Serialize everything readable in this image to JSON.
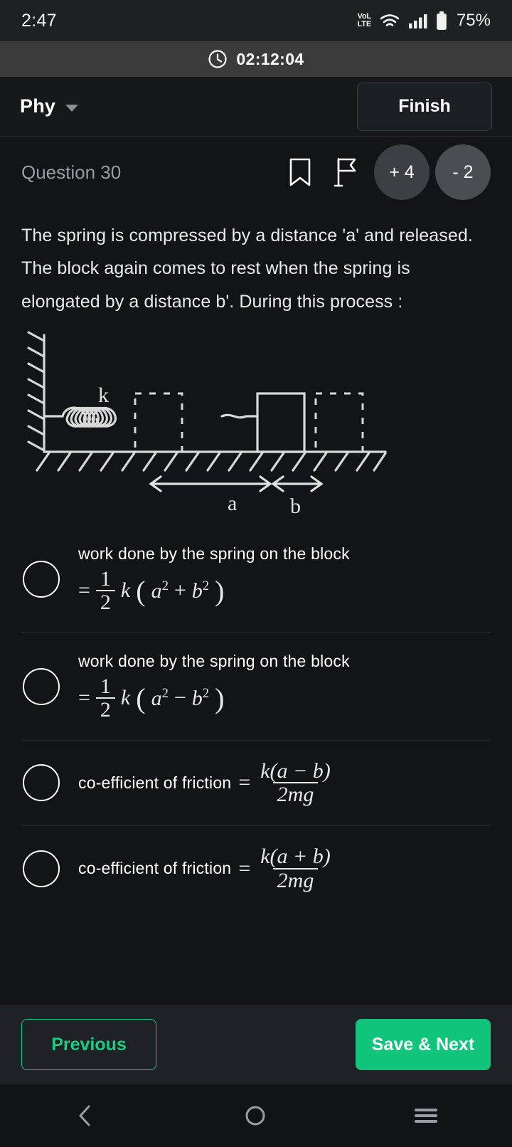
{
  "status_bar": {
    "time": "2:47",
    "volte_line1": "VoL",
    "volte_line2": "LTE",
    "wifi_icon": "wifi-icon",
    "signal_icon": "signal-bars-icon",
    "battery_icon": "battery-icon",
    "battery_percent": "75%"
  },
  "timer": {
    "clock_icon": "clock-icon",
    "value": "02:12:04"
  },
  "header": {
    "subject": "Phy",
    "dropdown_icon": "chevron-down-icon",
    "finish_label": "Finish"
  },
  "question_meta": {
    "label": "Question 30",
    "bookmark_icon": "bookmark-icon",
    "flag_icon": "flag-icon",
    "positive_marks": "+ 4",
    "negative_marks": "- 2"
  },
  "question": {
    "text": "The spring is compressed by a distance 'a' and released. The block again comes to rest when the spring is elongated by a distance b'. During this process :",
    "diagram": {
      "spring_label": "k",
      "distance_label_left": "a",
      "distance_label_right": "b",
      "description": "spring-block-friction-diagram"
    }
  },
  "options": [
    {
      "id": "option-a",
      "label": "work done by the spring on the block",
      "math": {
        "equals": "=",
        "frac_num": "1",
        "frac_den": "2",
        "coefficient": "k",
        "open_paren": "(",
        "term1_base": "a",
        "term1_exp": "2",
        "operator": "+",
        "term2_base": "b",
        "term2_exp": "2",
        "close_paren": ")"
      },
      "selected": false
    },
    {
      "id": "option-b",
      "label": "work done by the spring on the block",
      "math": {
        "equals": "=",
        "frac_num": "1",
        "frac_den": "2",
        "coefficient": "k",
        "open_paren": "(",
        "term1_base": "a",
        "term1_exp": "2",
        "operator": "−",
        "term2_base": "b",
        "term2_exp": "2",
        "close_paren": ")"
      },
      "selected": false
    },
    {
      "id": "option-c",
      "label": "co-efficient of friction",
      "math": {
        "equals": "=",
        "numerator": "k(a − b)",
        "denominator": "2mg"
      },
      "selected": false
    },
    {
      "id": "option-d",
      "label": "co-efficient of friction",
      "math": {
        "equals": "=",
        "numerator": "k(a + b)",
        "denominator": "2mg"
      },
      "selected": false
    }
  ],
  "actions": {
    "previous_label": "Previous",
    "save_next_label": "Save & Next"
  },
  "nav_bar": {
    "back_icon": "back-chevron-icon",
    "home_icon": "home-circle-icon",
    "recents_icon": "recents-menu-icon"
  },
  "colors": {
    "accent_green": "#11c47c",
    "background": "#121418",
    "timer_bar": "#3b3b3b",
    "action_bar": "#1e2125"
  }
}
